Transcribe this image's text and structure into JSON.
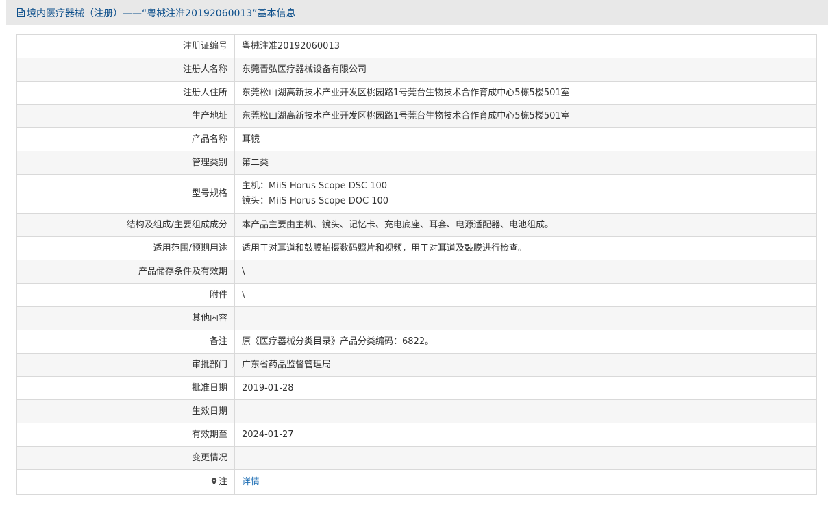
{
  "header": {
    "title": "境内医疗器械（注册）——“粤械注准20192060013”基本信息"
  },
  "rows": [
    {
      "label": "注册证编号",
      "value": "粤械注准20192060013"
    },
    {
      "label": "注册人名称",
      "value": "东莞晋弘医疗器械设备有限公司"
    },
    {
      "label": "注册人住所",
      "value": "东莞松山湖高新技术产业开发区桃园路1号莞台生物技术合作育成中心5栋5楼501室"
    },
    {
      "label": "生产地址",
      "value": "东莞松山湖高新技术产业开发区桃园路1号莞台生物技术合作育成中心5栋5楼501室"
    },
    {
      "label": "产品名称",
      "value": "耳镜"
    },
    {
      "label": "管理类别",
      "value": "第二类"
    },
    {
      "label": "型号规格",
      "value": "主机：MiiS Horus Scope DSC 100",
      "value2": "镜头：MiiS Horus Scope DOC 100"
    },
    {
      "label": "结构及组成/主要组成成分",
      "value": "本产品主要由主机、镜头、记忆卡、充电底座、耳套、电源适配器、电池组成。"
    },
    {
      "label": "适用范围/预期用途",
      "value": "适用于对耳道和鼓膜拍摄数码照片和视频，用于对耳道及鼓膜进行检查。"
    },
    {
      "label": "产品储存条件及有效期",
      "value": "\\"
    },
    {
      "label": "附件",
      "value": "\\"
    },
    {
      "label": "其他内容",
      "value": ""
    },
    {
      "label": "备注",
      "value": "原《医疗器械分类目录》产品分类编码：6822。"
    },
    {
      "label": "审批部门",
      "value": "广东省药品监督管理局"
    },
    {
      "label": "批准日期",
      "value": "2019-01-28"
    },
    {
      "label": "生效日期",
      "value": ""
    },
    {
      "label": "有效期至",
      "value": "2024-01-27"
    },
    {
      "label": "变更情况",
      "value": ""
    },
    {
      "label": "注",
      "value": "详情"
    }
  ],
  "colors": {
    "title": "#0d4f8b",
    "link": "#1f6fb5",
    "border": "#d9d9d9",
    "stripe": "#f6f6f6"
  },
  "icons": {
    "header": "document-icon",
    "note": "pin-icon"
  }
}
